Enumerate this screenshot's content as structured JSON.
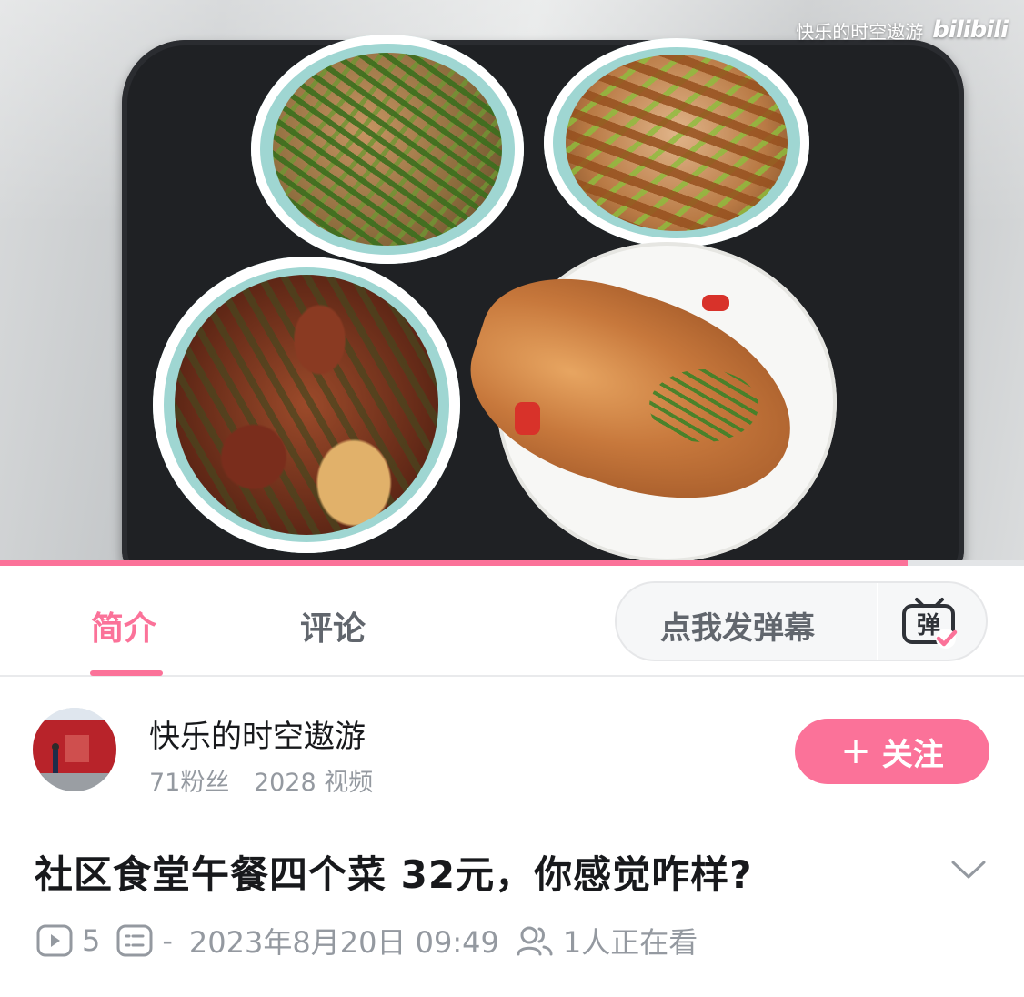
{
  "video": {
    "watermark_text": "快乐的时空遨游",
    "watermark_logo": "bilibili",
    "progress": 0.886
  },
  "tabs": {
    "intro_label": "简介",
    "comments_label": "评论",
    "danmaku_placeholder": "点我发弹幕",
    "danmaku_icon_text": "弹"
  },
  "uploader": {
    "name": "快乐的时空遨游",
    "fans": "71粉丝",
    "videos": "2028 视频",
    "follow_label": "关注"
  },
  "video_info": {
    "title": "社区食堂午餐四个菜 32元，你感觉咋样?",
    "plays": "5",
    "danmaku_count": "-",
    "date": "2023年8月20日 09:49",
    "watching": "1人正在看"
  },
  "colors": {
    "accent": "#fb7299",
    "text_primary": "#18191c",
    "text_secondary": "#9499a0"
  }
}
